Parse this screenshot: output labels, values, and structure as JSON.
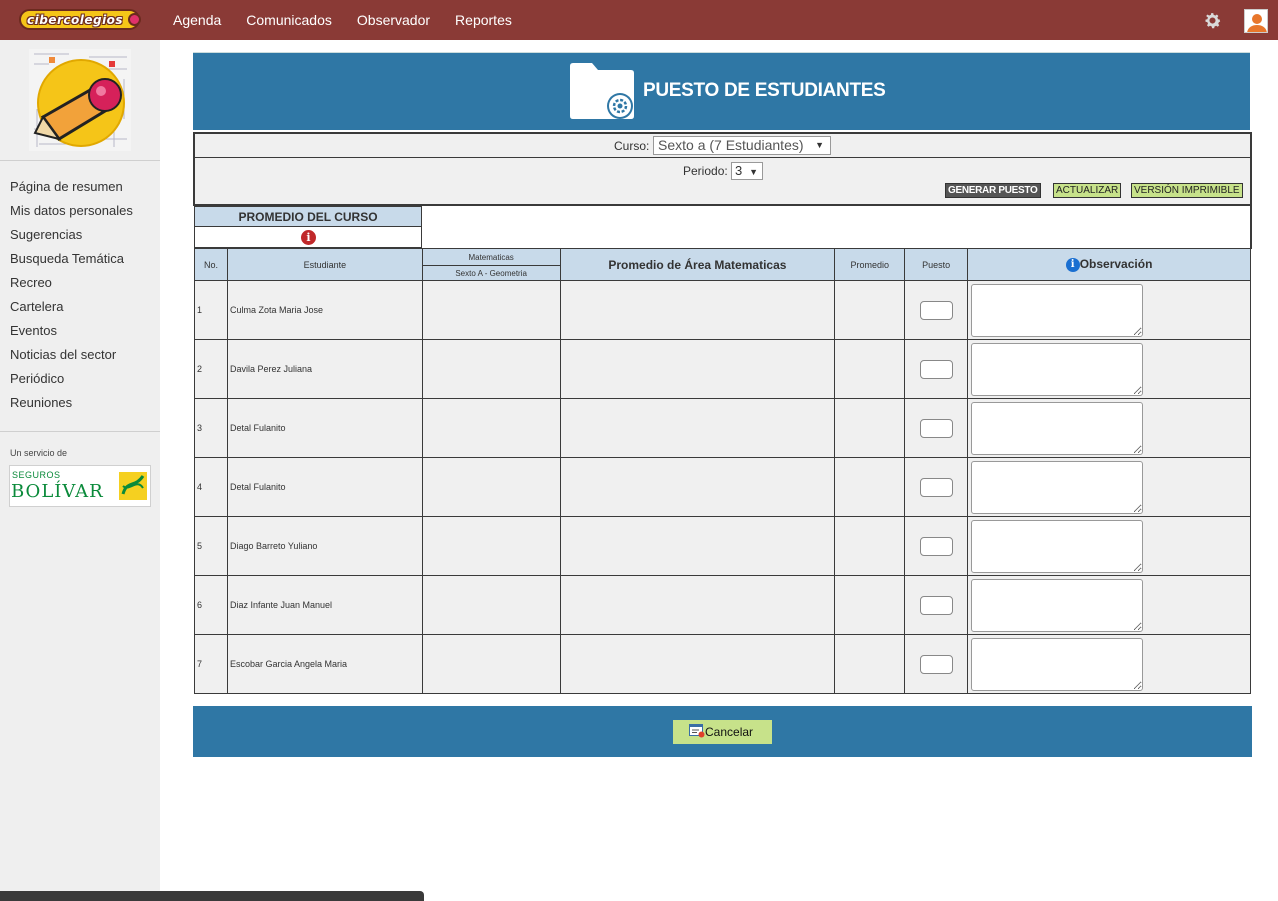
{
  "brand": {
    "name": "cibercolegios"
  },
  "topnav": [
    "Agenda",
    "Comunicados",
    "Observador",
    "Reportes"
  ],
  "sidebar": {
    "items": [
      "Página de resumen",
      "Mis datos personales",
      "Sugerencias",
      "Busqueda Temática",
      "Recreo",
      "Cartelera",
      "Eventos",
      "Noticias del sector",
      "Periódico",
      "Reuniones"
    ],
    "service_label": "Un servicio de",
    "sponsor_line1": "SEGUROS",
    "sponsor_line2": "BOLÍVAR"
  },
  "header": {
    "title": "PUESTO DE ESTUDIANTES"
  },
  "filters": {
    "curso_label": "Curso:",
    "curso_value": "Sexto a (7 Estudiantes)",
    "periodo_label": "Periodo:",
    "periodo_value": "3"
  },
  "actions": {
    "generar": "GENERAR PUESTO",
    "actualizar": "ACTUALIZAR",
    "imprimible": "VERSIÓN IMPRIMIBLE"
  },
  "promedio_curso": {
    "label": "PROMEDIO DEL CURSO",
    "icon": "info-red-icon"
  },
  "table": {
    "headers": {
      "no": "No.",
      "estudiante": "Estudiante",
      "materia_top": "Matematicas",
      "materia_bottom": "Sexto A - Geometria",
      "promedio_area": "Promedio de Área Matematicas",
      "promedio": "Promedio",
      "puesto": "Puesto",
      "observacion": "Observación"
    },
    "rows": [
      {
        "no": "1",
        "name": "Culma Zota Maria Jose"
      },
      {
        "no": "2",
        "name": "Davila Perez Juliana"
      },
      {
        "no": "3",
        "name": "Detal Fulanito"
      },
      {
        "no": "4",
        "name": "Detal Fulanito"
      },
      {
        "no": "5",
        "name": "Diago Barreto Yuliano"
      },
      {
        "no": "6",
        "name": "Diaz Infante Juan Manuel"
      },
      {
        "no": "7",
        "name": "Escobar Garcia Angela Maria"
      }
    ]
  },
  "footer": {
    "cancel": "Cancelar"
  },
  "colors": {
    "topbar": "#8a3a36",
    "header_blue": "#2f77a5",
    "accent_green": "#c7e28a",
    "table_head": "#c8daea"
  }
}
